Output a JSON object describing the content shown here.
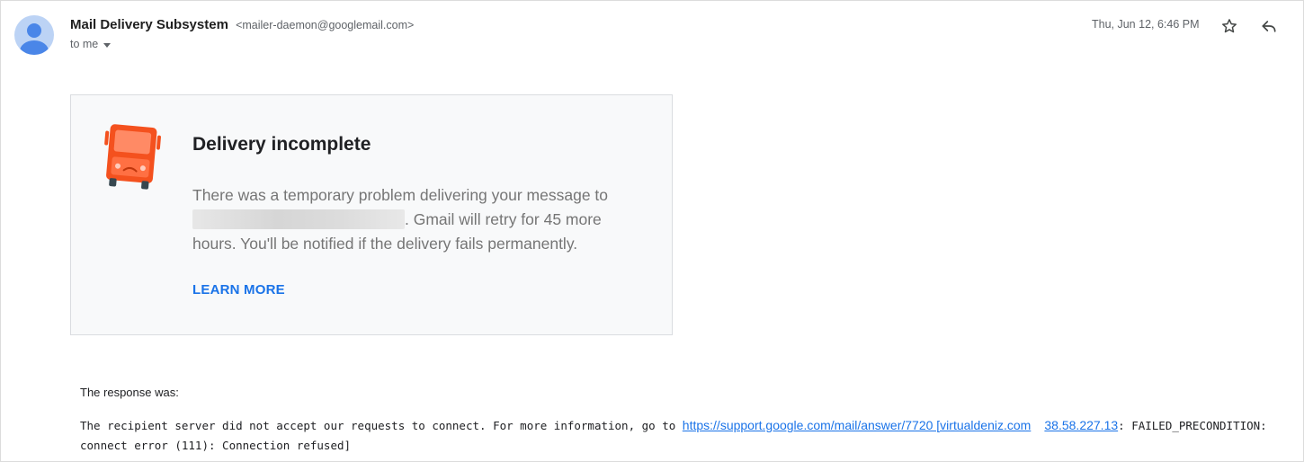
{
  "header": {
    "sender_name": "Mail Delivery Subsystem",
    "sender_email": "<mailer-daemon@googlemail.com>",
    "recipient": "to me",
    "timestamp": "Thu, Jun 12, 6:46 PM",
    "icons": [
      "avatar",
      "star-icon",
      "reply-icon",
      "chevron-down-icon"
    ]
  },
  "card": {
    "title": "Delivery incomplete",
    "body_before": "There was a temporary problem delivering your message to",
    "body_after": ". Gmail will retry for 45 more hours. You'll be notified if the delivery fails permanently.",
    "learn_more": "LEARN MORE",
    "icon": "delivery-truck-icon",
    "accent_color": "#1a73e8",
    "truck_color": "#f4511e"
  },
  "response": {
    "label": "The response was:",
    "text_before": "The recipient server did not accept our requests to connect. For more information, go to ",
    "link1": "https://support.google.com/mail/answer/7720 [virtualdeniz.com",
    "link2": "38.58.227.13",
    "text_after": ": FAILED_PRECONDITION: connect error (111): Connection refused]"
  }
}
